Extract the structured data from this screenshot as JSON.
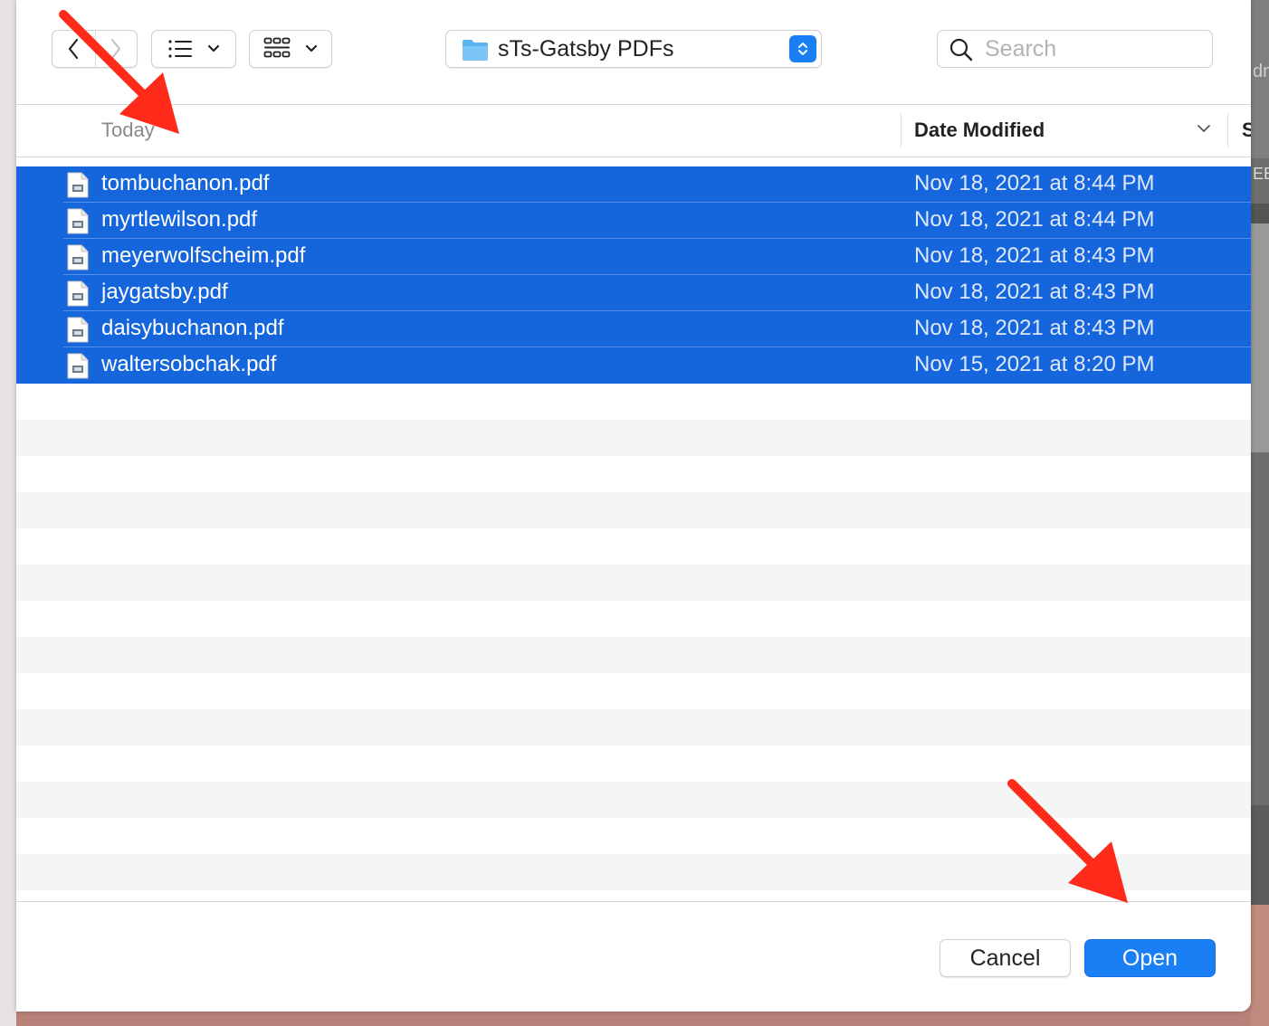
{
  "background_peek": {
    "top_text": "dn",
    "mid_text": "EE"
  },
  "toolbar": {
    "back_label": "back",
    "forward_label": "forward",
    "location": "sTs-Gatsby PDFs",
    "search_placeholder": "Search"
  },
  "columns": {
    "group_label": "Today",
    "date_label": "Date Modified",
    "next_label": "S"
  },
  "files": [
    {
      "name": "tombuchanon.pdf",
      "date": "Nov 18, 2021 at 8:44 PM"
    },
    {
      "name": "myrtlewilson.pdf",
      "date": "Nov 18, 2021 at 8:44 PM"
    },
    {
      "name": "meyerwolfscheim.pdf",
      "date": "Nov 18, 2021 at 8:43 PM"
    },
    {
      "name": "jaygatsby.pdf",
      "date": "Nov 18, 2021 at 8:43 PM"
    },
    {
      "name": "daisybuchanon.pdf",
      "date": "Nov 18, 2021 at 8:43 PM"
    },
    {
      "name": "waltersobchak.pdf",
      "date": "Nov 15, 2021 at 8:20 PM"
    }
  ],
  "footer": {
    "cancel_label": "Cancel",
    "open_label": "Open"
  },
  "colors": {
    "selection": "#1565dc",
    "accent": "#1a7ef5",
    "annotation_arrow": "#ff2a1a"
  },
  "icons": [
    "back-chevron-icon",
    "forward-chevron-icon",
    "list-view-icon",
    "grid-view-icon",
    "chevron-down-icon",
    "folder-icon",
    "stepper-icon",
    "search-icon",
    "pdf-file-icon",
    "sort-chevron-icon",
    "annotation-arrow"
  ]
}
